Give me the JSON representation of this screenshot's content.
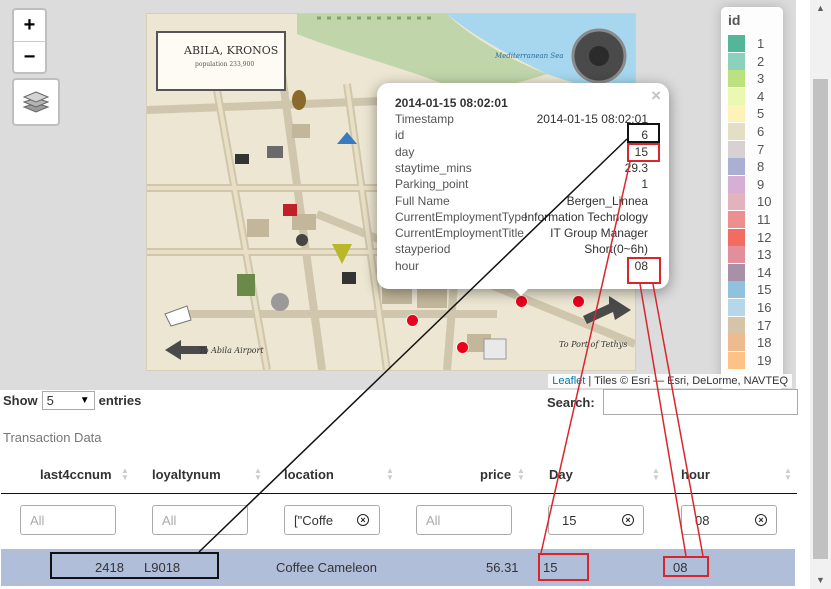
{
  "map": {
    "zoom_in": "+",
    "zoom_out": "−",
    "layers_icon": "layers-icon",
    "tourist_map": {
      "title": "ABILA, KRONOS",
      "subtitle": "population 233,900",
      "sea_label": "Mediterranean Sea",
      "to_airport": "To Abila Airport",
      "to_port": "To Port of Tethys"
    },
    "attribution": {
      "leaflet": "Leaflet",
      "rest": " | Tiles © Esri — Esri, DeLorme, NAVTEQ"
    },
    "legend": {
      "title": "id",
      "items": [
        {
          "label": "1",
          "color": "#1b9e77"
        },
        {
          "label": "2",
          "color": "#66c2a5"
        },
        {
          "label": "3",
          "color": "#a6d854"
        },
        {
          "label": "4",
          "color": "#e6f598"
        },
        {
          "label": "5",
          "color": "#ffeda0"
        },
        {
          "label": "6",
          "color": "#d9d3b0"
        },
        {
          "label": "7",
          "color": "#c9c1c1"
        },
        {
          "label": "8",
          "color": "#8c96c6"
        },
        {
          "label": "9",
          "color": "#c994c7"
        },
        {
          "label": "10",
          "color": "#d89aa6"
        },
        {
          "label": "11",
          "color": "#e46a6a"
        },
        {
          "label": "12",
          "color": "#ef3b2c"
        },
        {
          "label": "13",
          "color": "#d86a7a"
        },
        {
          "label": "14",
          "color": "#8c6b8c"
        },
        {
          "label": "15",
          "color": "#6baed6"
        },
        {
          "label": "16",
          "color": "#9ecae1"
        },
        {
          "label": "17",
          "color": "#c7b08a"
        },
        {
          "label": "18",
          "color": "#e8a36a"
        },
        {
          "label": "19",
          "color": "#fdae61"
        }
      ]
    },
    "popup": {
      "close": "×",
      "title": "2014-01-15 08:02:01",
      "rows": [
        {
          "key": "Timestamp",
          "value": "2014-01-15 08:02:01"
        },
        {
          "key": "id",
          "value": "6"
        },
        {
          "key": "day",
          "value": "15"
        },
        {
          "key": "staytime_mins",
          "value": "29.3"
        },
        {
          "key": "Parking_point",
          "value": "1"
        },
        {
          "key": "Full Name",
          "value": "Bergen_Linnea"
        },
        {
          "key": "CurrentEmploymentType",
          "value": "Information Technology"
        },
        {
          "key": "CurrentEmploymentTitle",
          "value": "IT Group Manager"
        },
        {
          "key": "stayperiod",
          "value": "Short(0~6h)"
        },
        {
          "key": "hour",
          "value": "08"
        }
      ]
    }
  },
  "table": {
    "show_label": "Show",
    "entries_value": "5",
    "entries_label": "entries",
    "search_label": "Search:",
    "caption": "Transaction Data",
    "headers": [
      "last4ccnum",
      "loyaltynum",
      "location",
      "price",
      "Day",
      "hour"
    ],
    "filters": {
      "last4ccnum": "All",
      "loyaltynum": "All",
      "location": "[\"Coffe",
      "price": "All",
      "day": "15",
      "hour": "08"
    },
    "row": {
      "last4ccnum": "2418",
      "loyaltynum": "L9018",
      "location": "Coffee Cameleon",
      "price": "56.31",
      "day": "15",
      "hour": "08"
    }
  },
  "colors": {
    "annotation_red": "#d9262c",
    "annotation_black": "#111111",
    "selected_row": "#b0bed9",
    "marker": "#e8001c"
  }
}
